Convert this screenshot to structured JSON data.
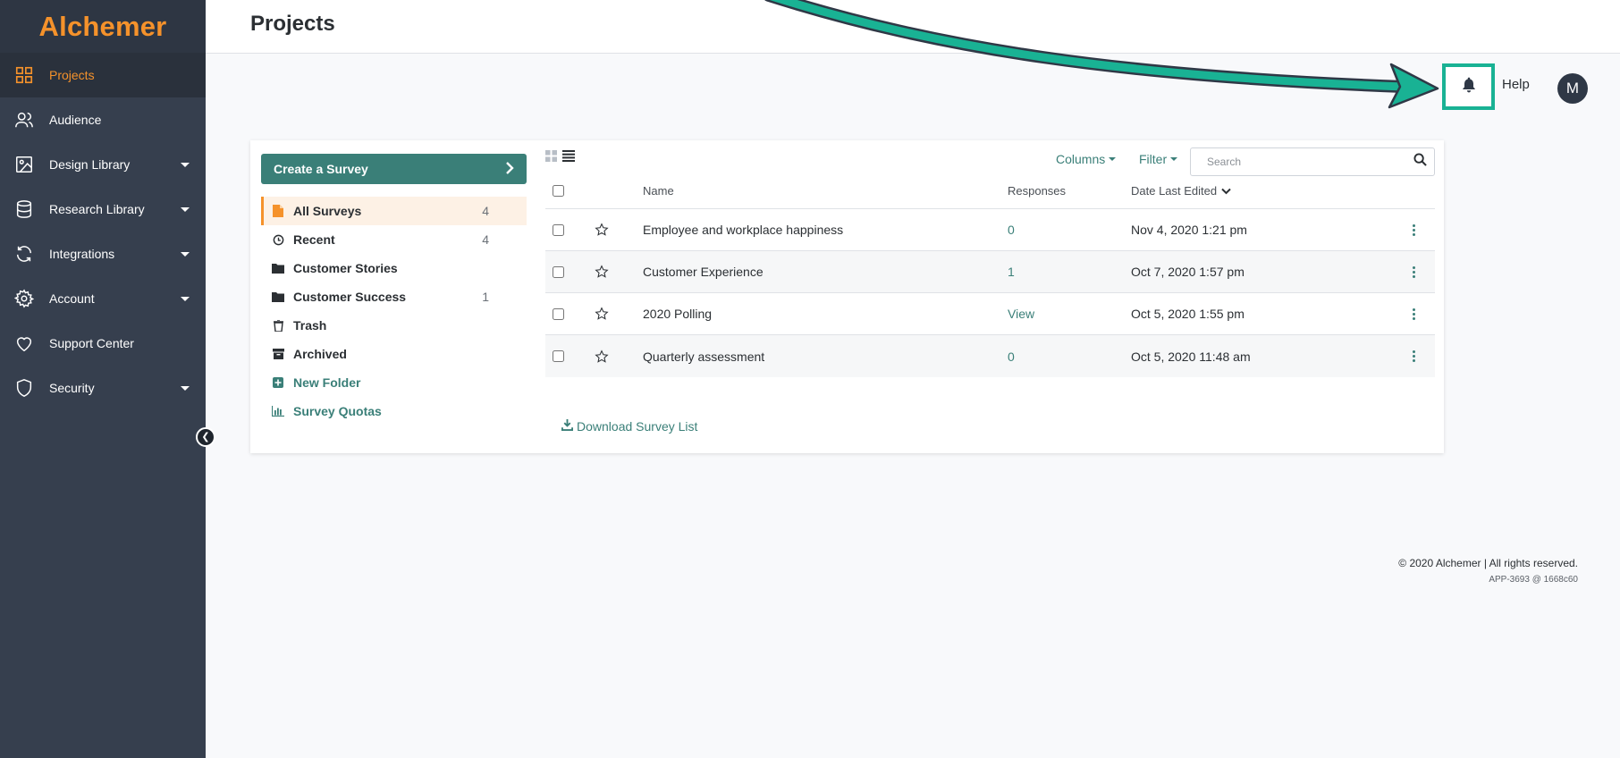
{
  "app": {
    "logo_text": "Alchemer"
  },
  "colors": {
    "sidebar": "#363f4e",
    "accent_orange": "#f5922b",
    "primary_teal": "#3a7f78",
    "highlight_green": "#19b294"
  },
  "sidebar": {
    "items": [
      {
        "label": "Projects",
        "icon": "grid-icon",
        "active": true,
        "has_caret": false
      },
      {
        "label": "Audience",
        "icon": "users-icon",
        "active": false,
        "has_caret": false
      },
      {
        "label": "Design Library",
        "icon": "image-icon",
        "active": false,
        "has_caret": true
      },
      {
        "label": "Research Library",
        "icon": "database-icon",
        "active": false,
        "has_caret": true
      },
      {
        "label": "Integrations",
        "icon": "sync-icon",
        "active": false,
        "has_caret": true
      },
      {
        "label": "Account",
        "icon": "gear-icon",
        "active": false,
        "has_caret": true
      },
      {
        "label": "Support Center",
        "icon": "heart-icon",
        "active": false,
        "has_caret": false
      },
      {
        "label": "Security",
        "icon": "shield-icon",
        "active": false,
        "has_caret": true
      }
    ],
    "collapse_icon": "chevron-left-icon"
  },
  "header": {
    "title": "Projects",
    "help_label": "Help",
    "avatar_initial": "M",
    "bell_icon": "bell-icon"
  },
  "folders": {
    "create_label": "Create a Survey",
    "items": [
      {
        "label": "All Surveys",
        "count": "4",
        "icon": "file-icon",
        "active": true
      },
      {
        "label": "Recent",
        "count": "4",
        "icon": "clock-icon",
        "active": false
      },
      {
        "label": "Customer Stories",
        "count": "",
        "icon": "folder-icon",
        "active": false
      },
      {
        "label": "Customer Success",
        "count": "1",
        "icon": "folder-icon",
        "active": false
      },
      {
        "label": "Trash",
        "count": "",
        "icon": "trash-icon",
        "active": false
      },
      {
        "label": "Archived",
        "count": "",
        "icon": "archive-icon",
        "active": false
      }
    ],
    "new_folder_label": "New Folder",
    "quotas_label": "Survey Quotas"
  },
  "toolbar": {
    "columns_label": "Columns",
    "filter_label": "Filter",
    "search_placeholder": "Search"
  },
  "table": {
    "headers": {
      "name": "Name",
      "responses": "Responses",
      "date": "Date Last Edited"
    },
    "rows": [
      {
        "name": "Employee and workplace happiness",
        "responses": "0",
        "date": "Nov 4, 2020 1:21 pm"
      },
      {
        "name": "Customer Experience",
        "responses": "1",
        "date": "Oct 7, 2020 1:57 pm"
      },
      {
        "name": "2020 Polling",
        "responses": "View",
        "date": "Oct 5, 2020 1:55 pm"
      },
      {
        "name": "Quarterly assessment",
        "responses": "0",
        "date": "Oct 5, 2020 11:48 am"
      }
    ]
  },
  "download_label": "Download Survey List",
  "footer": {
    "copyright": "© 2020 Alchemer | All rights reserved.",
    "build": "APP-3693 @ 1668c60"
  }
}
